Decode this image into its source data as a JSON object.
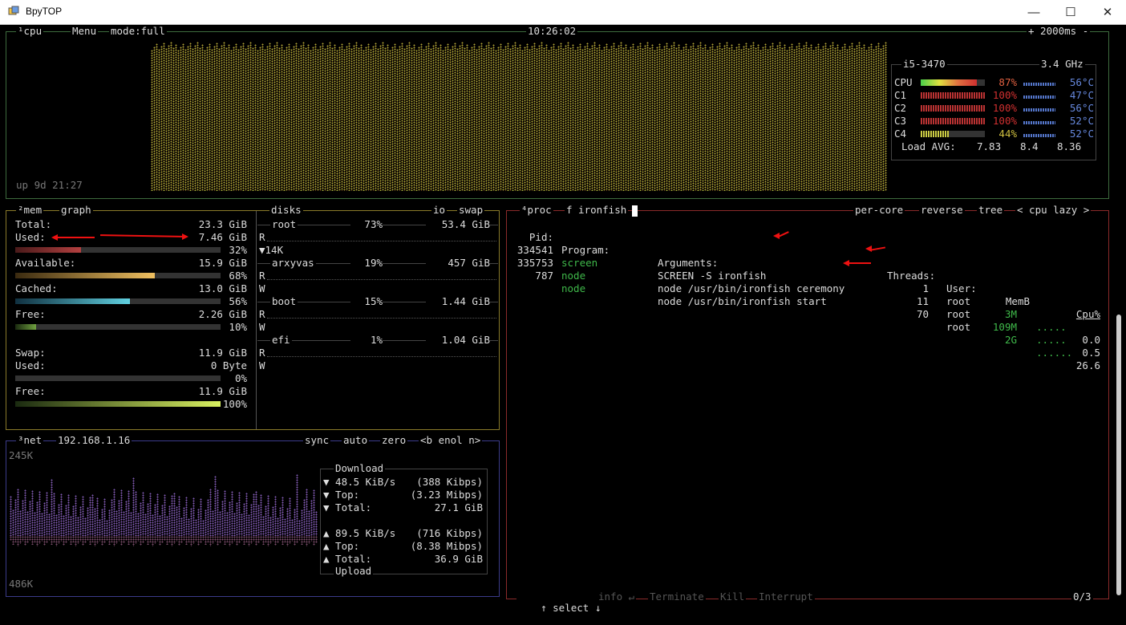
{
  "window": {
    "title": "BpyTOP",
    "minimize": "—",
    "maximize": "☐",
    "close": "✕"
  },
  "cpu": {
    "tab": "¹cpu",
    "menu": "Menu",
    "mode": "mode:full",
    "clock": "10:26:02",
    "interval": "+ 2000ms -",
    "uptime": "up 9d 21:27",
    "model": "i5-3470",
    "freq": "3.4 GHz",
    "rows": [
      {
        "name": "CPU",
        "pct": "87%",
        "temp": "56°C",
        "value": 0.87
      },
      {
        "name": "C1",
        "pct": "100%",
        "temp": "47°C",
        "value": 1.0
      },
      {
        "name": "C2",
        "pct": "100%",
        "temp": "56°C",
        "value": 1.0
      },
      {
        "name": "C3",
        "pct": "100%",
        "temp": "52°C",
        "value": 1.0
      },
      {
        "name": "C4",
        "pct": "44%",
        "temp": "52°C",
        "value": 0.44
      }
    ],
    "load_label": "Load AVG:",
    "load": [
      "7.83",
      "8.4",
      "8.36"
    ]
  },
  "mem": {
    "tab": "²mem",
    "graph": "graph",
    "disks": "disks",
    "io": "io",
    "swap": "swap",
    "total_label": "Total:",
    "total": "23.3 GiB",
    "used_label": "Used:",
    "used": "7.46 GiB",
    "used_pct": "32%",
    "used_value": 0.32,
    "avail_label": "Available:",
    "avail": "15.9 GiB",
    "avail_pct": "68%",
    "avail_value": 0.68,
    "cached_label": "Cached:",
    "cached": "13.0 GiB",
    "cached_pct": "56%",
    "cached_value": 0.56,
    "free_label": "Free:",
    "free": "2.26 GiB",
    "free_pct": "10%",
    "free_value": 0.1,
    "swap_label": "Swap:",
    "swap_total": "11.9 GiB",
    "swap_used_label": "Used:",
    "swap_used": "0 Byte",
    "swap_used_pct": "0%",
    "swap_used_value": 0.0,
    "swap_free_label": "Free:",
    "swap_free": "11.9 GiB",
    "swap_free_pct": "100%",
    "swap_free_value": 1.0
  },
  "disks": [
    {
      "name": "root",
      "pct": "73%",
      "size": "53.4 GiB",
      "io": "▼14K"
    },
    {
      "name": "arxyvas",
      "pct": "19%",
      "size": "457 GiB",
      "io": ""
    },
    {
      "name": "boot",
      "pct": "15%",
      "size": "1.44 GiB",
      "io": ""
    },
    {
      "name": "efi",
      "pct": "1%",
      "size": "1.04 GiB",
      "io": ""
    }
  ],
  "disk_r": "R",
  "disk_w": "W",
  "net": {
    "tab": "³net",
    "ip": "192.168.1.16",
    "sync": "sync",
    "auto": "auto",
    "zero": "zero",
    "iface": "<b enol n>",
    "top_scale": "245K",
    "bottom_scale": "486K",
    "download_title": "Download",
    "upload_title": "Upload",
    "down_rate": "▼ 48.5 KiB/s",
    "down_rate_bits": "(388 Kibps)",
    "down_top_label": "▼ Top:",
    "down_top": "(3.23 Mibps)",
    "down_total_label": "▼ Total:",
    "down_total": "27.1 GiB",
    "up_rate": "▲ 89.5 KiB/s",
    "up_rate_bits": "(716 Kibps)",
    "up_top_label": "▲ Top:",
    "up_top": "(8.38 Mibps)",
    "up_total_label": "▲ Total:",
    "up_total": "36.9 GiB"
  },
  "proc": {
    "tab": "⁴proc",
    "filter": "f ironfish",
    "per_core": "per-core",
    "reverse": "reverse",
    "tree": "tree",
    "sort": "< cpu lazy >",
    "headers": {
      "pid": "Pid:",
      "program": "Program:",
      "args": "Arguments:",
      "threads": "Threads:",
      "user": "User:",
      "mem": "MemB",
      "cpu": "Cpu%"
    },
    "rows": [
      {
        "pid": "334541",
        "program": "screen",
        "args": "SCREEN -S ironfish",
        "threads": "1",
        "user": "root",
        "mem": "3M",
        "spark": ".....",
        "cpu": "0.0"
      },
      {
        "pid": "335753",
        "program": "node",
        "args": "node /usr/bin/ironfish ceremony",
        "threads": "11",
        "user": "root",
        "mem": "109M",
        "spark": ".....",
        "cpu": "0.5"
      },
      {
        "pid": "787",
        "program": "node",
        "args": "node /usr/bin/ironfish start",
        "threads": "70",
        "user": "root",
        "mem": "2G",
        "spark": "......",
        "cpu": "26.6"
      }
    ],
    "footer": {
      "select": "↑ select ↓",
      "info": "info ↵",
      "terminate": "Terminate",
      "kill": "Kill",
      "interrupt": "Interrupt",
      "count": "0/3"
    }
  }
}
